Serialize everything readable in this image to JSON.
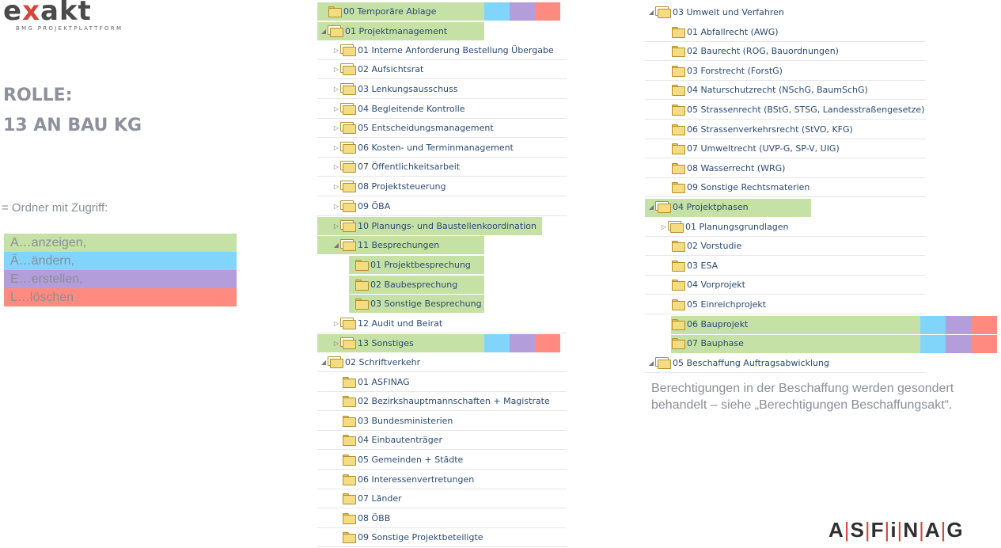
{
  "logo": {
    "word_a": "e",
    "word_x": "x",
    "word_b": "akt",
    "subtitle": "BMG PROJEKTPLATTFORM"
  },
  "role": {
    "line1": "ROLLE:",
    "line2": "13 AN BAU KG"
  },
  "access_label": "= Ordner mit Zugriff:",
  "legend": [
    {
      "label": "A…anzeigen,",
      "color": "#c5e1a5"
    },
    {
      "label": "Ä…ändern,",
      "color": "#81d4fa"
    },
    {
      "label": "E…erstellen,",
      "color": "#b39ddb"
    },
    {
      "label": "L…löschen",
      "color": "#ff8a80"
    }
  ],
  "colors": {
    "anzeigen": "#c5e1a5",
    "aendern": "#81d4fa",
    "erstellen": "#b39ddb",
    "loeschen": "#ff8a80"
  },
  "tree_left": [
    {
      "label": "00 Temporäre Ablage",
      "toggle": "",
      "stack": false
    },
    {
      "label": "01 Projektmanagement",
      "toggle": "◢",
      "stack": true
    },
    {
      "label": "01 Interne Anforderung Bestellung Übergabe",
      "toggle": "▷",
      "stack": true
    },
    {
      "label": "02 Aufsichtsrat",
      "toggle": "▷",
      "stack": true
    },
    {
      "label": "03 Lenkungsausschuss",
      "toggle": "▷",
      "stack": true
    },
    {
      "label": "04 Begleitende Kontrolle",
      "toggle": "▷",
      "stack": true
    },
    {
      "label": "05 Entscheidungsmanagement",
      "toggle": "▷",
      "stack": true
    },
    {
      "label": "06 Kosten- und Terminmanagement",
      "toggle": "▷",
      "stack": true
    },
    {
      "label": "07 Öffentlichkeitsarbeit",
      "toggle": "▷",
      "stack": true
    },
    {
      "label": "08 Projektsteuerung",
      "toggle": "▷",
      "stack": true
    },
    {
      "label": "09 ÖBA",
      "toggle": "▷",
      "stack": true
    },
    {
      "label": "10 Planungs- und Baustellenkoordination",
      "toggle": "▷",
      "stack": true
    },
    {
      "label": "11 Besprechungen",
      "toggle": "◢",
      "stack": true
    },
    {
      "label": "01 Projektbesprechung",
      "toggle": "",
      "stack": false
    },
    {
      "label": "02 Baubesprechung",
      "toggle": "",
      "stack": false
    },
    {
      "label": "03 Sonstige Besprechung",
      "toggle": "",
      "stack": false
    },
    {
      "label": "12 Audit und Beirat",
      "toggle": "▷",
      "stack": true
    },
    {
      "label": "13 Sonstiges",
      "toggle": "▷",
      "stack": true
    },
    {
      "label": "02 Schriftverkehr",
      "toggle": "◢",
      "stack": true
    },
    {
      "label": "01 ASFINAG",
      "toggle": "",
      "stack": false
    },
    {
      "label": "02 Bezirkshauptmannschaften + Magistrate",
      "toggle": "",
      "stack": false
    },
    {
      "label": "03 Bundesministerien",
      "toggle": "",
      "stack": false
    },
    {
      "label": "04 Einbautenträger",
      "toggle": "",
      "stack": false
    },
    {
      "label": "05 Gemeinden + Städte",
      "toggle": "",
      "stack": false
    },
    {
      "label": "06 Interessenvertretungen",
      "toggle": "",
      "stack": false
    },
    {
      "label": "07 Länder",
      "toggle": "",
      "stack": false
    },
    {
      "label": "08 ÖBB",
      "toggle": "",
      "stack": false
    },
    {
      "label": "09 Sonstige Projektbeteiligte",
      "toggle": "",
      "stack": false
    }
  ],
  "tree_right": [
    {
      "label": "03 Umwelt und Verfahren",
      "toggle": "◢",
      "stack": true
    },
    {
      "label": "01 Abfallrecht (AWG)",
      "toggle": "",
      "stack": false
    },
    {
      "label": "02 Baurecht (ROG, Bauordnungen)",
      "toggle": "",
      "stack": false
    },
    {
      "label": "03 Forstrecht (ForstG)",
      "toggle": "",
      "stack": false
    },
    {
      "label": "04 Naturschutzrecht (NSchG, BaumSchG)",
      "toggle": "",
      "stack": false
    },
    {
      "label": "05 Strassenrecht (BStG, STSG, Landesstraßengesetze)",
      "toggle": "",
      "stack": false
    },
    {
      "label": "06 Strassenverkehrsrecht (StVO, KFG)",
      "toggle": "",
      "stack": false
    },
    {
      "label": "07 Umweltrecht (UVP-G, SP-V, UIG)",
      "toggle": "",
      "stack": false
    },
    {
      "label": "08 Wasserrecht (WRG)",
      "toggle": "",
      "stack": false
    },
    {
      "label": "09 Sonstige Rechtsmaterien",
      "toggle": "",
      "stack": false
    },
    {
      "label": "04 Projektphasen",
      "toggle": "◢",
      "stack": true
    },
    {
      "label": "01 Planungsgrundlagen",
      "toggle": "▷",
      "stack": true
    },
    {
      "label": "02 Vorstudie",
      "toggle": "",
      "stack": false
    },
    {
      "label": "03 ESA",
      "toggle": "",
      "stack": false
    },
    {
      "label": "04 Vorprojekt",
      "toggle": "",
      "stack": false
    },
    {
      "label": "05 Einreichprojekt",
      "toggle": "",
      "stack": false
    },
    {
      "label": "06 Bauprojekt",
      "toggle": "",
      "stack": false
    },
    {
      "label": "07 Bauphase",
      "toggle": "",
      "stack": false
    },
    {
      "label": "05 Beschaffung Auftragsabwicklung",
      "toggle": "◢",
      "stack": true
    }
  ],
  "note": "Berechtigungen in der Beschaffung werden gesondert behandelt – siehe „Berechtigungen Beschaffungsakt“.",
  "brand": {
    "letters": [
      "A",
      "S",
      "F",
      "i",
      "N",
      "A",
      "G"
    ],
    "separator": "|"
  }
}
